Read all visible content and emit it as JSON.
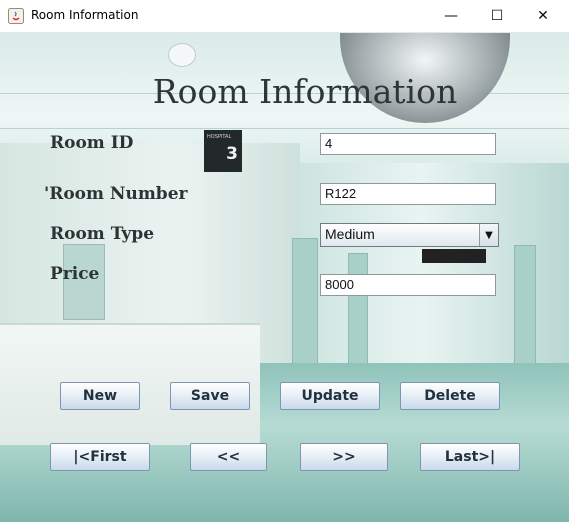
{
  "window": {
    "title": "Room Information",
    "minimize_glyph": "—",
    "maximize_glyph": "☐",
    "close_glyph": "✕"
  },
  "background": {
    "sign_text": "HOSPITAL",
    "sign_number": "3"
  },
  "form": {
    "heading": "Room Information",
    "room_id_label": "Room ID",
    "room_id_value": "4",
    "room_number_label": "'Room Number",
    "room_number_value": "R122",
    "room_type_label": "Room Type",
    "room_type_value": "Medium",
    "price_label": "Price",
    "price_value": "8000"
  },
  "buttons": {
    "new": "New",
    "save": "Save",
    "update": "Update",
    "delete": "Delete",
    "first": "|<First",
    "prev": "<<",
    "next": ">>",
    "last": "Last>|"
  },
  "colors": {
    "accent": "#7c96b3",
    "heading": "#2f3537"
  }
}
